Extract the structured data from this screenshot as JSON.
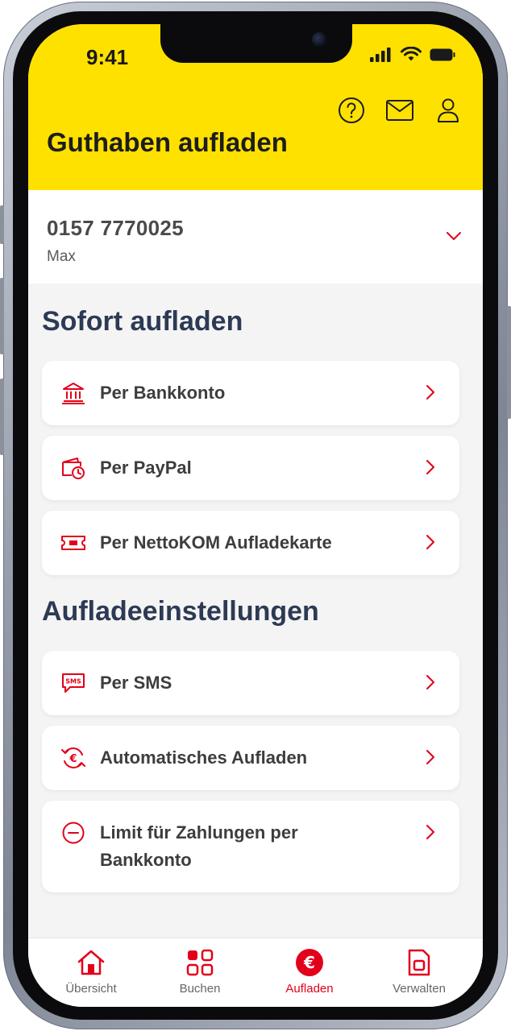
{
  "status_bar": {
    "time": "9:41"
  },
  "header": {
    "title": "Guthaben aufladen",
    "icons": [
      "help-icon",
      "mail-icon",
      "user-icon"
    ]
  },
  "account": {
    "number": "0157 7770025",
    "name": "Max"
  },
  "sections": [
    {
      "title": "Sofort aufladen",
      "items": [
        {
          "label": "Per Bankkonto",
          "icon": "bank-icon"
        },
        {
          "label": "Per PayPal",
          "icon": "wallet-clock-icon"
        },
        {
          "label": "Per NettoKOM Aufladekarte",
          "icon": "ticket-icon"
        }
      ]
    },
    {
      "title": "Aufladeeinstellungen",
      "items": [
        {
          "label": "Per SMS",
          "icon": "sms-icon"
        },
        {
          "label": "Automatisches Aufladen",
          "icon": "euro-cycle-icon"
        },
        {
          "label": "Limit für Zahlungen per Bankkonto",
          "icon": "minus-circle-icon"
        }
      ]
    }
  ],
  "bottom_nav": [
    {
      "label": "Übersicht",
      "icon": "home-icon",
      "active": false
    },
    {
      "label": "Buchen",
      "icon": "grid-icon",
      "active": false
    },
    {
      "label": "Aufladen",
      "icon": "euro-icon",
      "active": true
    },
    {
      "label": "Verwalten",
      "icon": "sim-card-icon",
      "active": false
    }
  ],
  "colors": {
    "accent": "#e2001a",
    "header": "#ffe100",
    "heading": "#2d3a55",
    "background": "#f4f4f4"
  }
}
